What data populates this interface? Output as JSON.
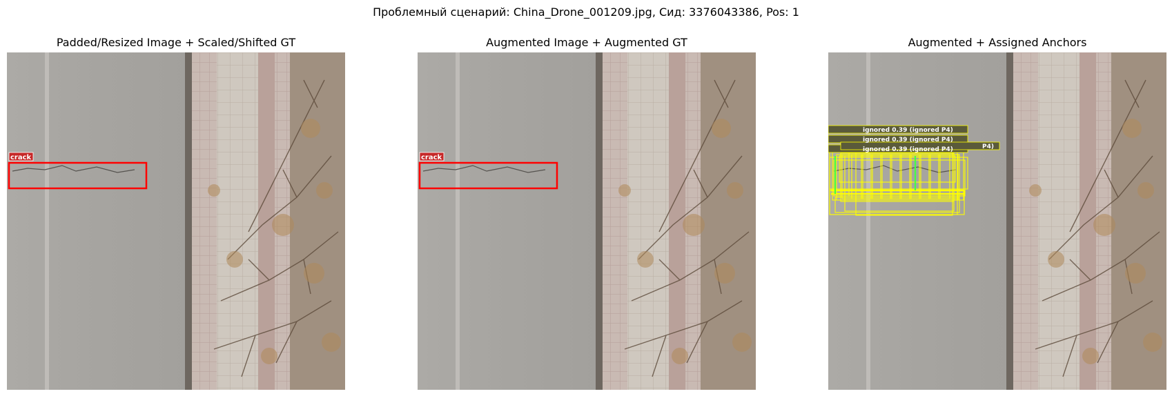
{
  "figure": {
    "suptitle": "Проблемный сценарий: China_Drone_001209.jpg, Сид: 3376043386, Pos: 1"
  },
  "panels": [
    {
      "title": "Padded/Resized Image + Scaled/Shifted GT",
      "box_label": "crack"
    },
    {
      "title": "Augmented Image + Augmented GT",
      "box_label": "crack"
    },
    {
      "title": "Augmented + Assigned Anchors",
      "anchor_label": "ignored 0.39 (ignored P4)",
      "anchor_label_short": "P4)"
    }
  ],
  "colors": {
    "gt_box": "#ff0000",
    "gt_label_bg": "#c62828",
    "anchor_box": "#ffff00",
    "anchor_positive": "#44ff44",
    "road": "#a9a7a3",
    "sidewalk": "#c9b4b0",
    "dirt": "#9a8a78"
  }
}
